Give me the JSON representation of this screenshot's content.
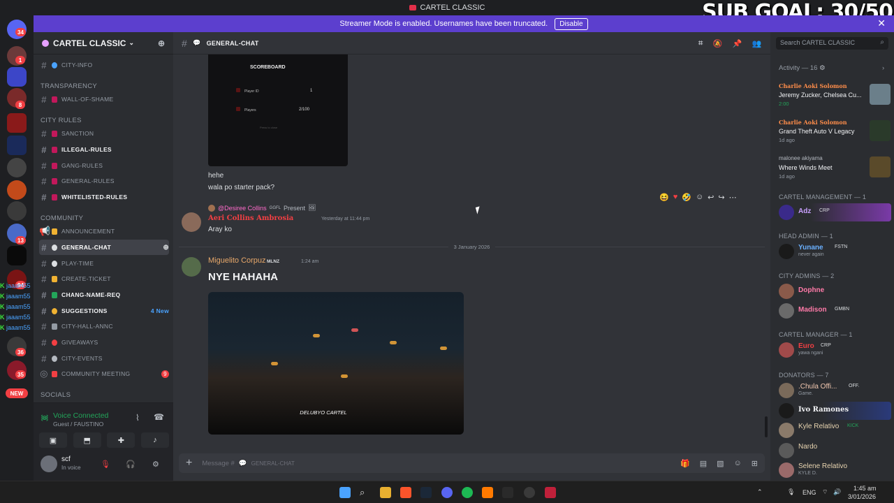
{
  "window": {
    "title": "CARTEL CLASSIC"
  },
  "overlay": {
    "sub_goal": "SUB GOAL: 30/50",
    "names": [
      "jaaam55",
      "jaaam55",
      "jaaam55",
      "jaaam55",
      "jaaam55"
    ]
  },
  "banner": {
    "text": "Streamer Mode is enabled. Usernames have been truncated.",
    "button": "Disable"
  },
  "rail": {
    "badges": [
      "34",
      "1",
      "8",
      "13",
      "94",
      "36",
      "35"
    ],
    "new_label": "NEW"
  },
  "server": {
    "name": "CARTEL CLASSIC"
  },
  "channels": {
    "city_info": "CITY-INFO",
    "cat_transparency": "TRANSPARENCY",
    "wall_of_shame": "WALL-OF-SHAME",
    "cat_city_rules": "CITY RULES",
    "sanction": "SANCTION",
    "illegal_rules": "ILLEGAL-RULES",
    "gang_rules": "GANG-RULES",
    "general_rules": "GENERAL-RULES",
    "whitelisted_rules": "WHITELISTED-RULES",
    "cat_community": "COMMUNITY",
    "announcement": "ANNOUNCEMENT",
    "general_chat": "GENERAL-CHAT",
    "play_time": "PLAY-TIME",
    "create_ticket": "CREATE-TICKET",
    "chang_name_req": "CHANG-NAME-REQ",
    "suggestions": "SUGGESTIONS",
    "suggestions_count": "4 New",
    "city_hall_annc": "CITY-HALL-ANNC",
    "giveaways": "GIVEAWAYS",
    "city_events": "CITY-EVENTS",
    "community_meeting": "COMMUNITY MEETING",
    "community_meeting_count": "9",
    "cat_socials": "SOCIALS"
  },
  "voice": {
    "status": "Voice Connected",
    "channel": "Guest / FAUSTINO"
  },
  "user": {
    "name": "scf",
    "status": "In voice"
  },
  "chat": {
    "channel": "GENERAL-CHAT",
    "scoreboard": {
      "title": "SCOREBOARD",
      "row1_label": "Player ID",
      "row1_value": "1",
      "row2_label": "Players",
      "row2_value": "2/100",
      "footer": "Press to close"
    },
    "msg1": "hehe",
    "msg2": "wala po starter pack?",
    "reply_name": "@Desiree Collins",
    "reply_tag": "GGFL",
    "reply_text": "Present",
    "user2": "Aeri Collins Ambrosia",
    "user2_time": "Yesterday at 11:44 pm",
    "msg3": "Aray ko",
    "date_divider": "3 January 2026",
    "user3": "Miguelito Corpuz",
    "user3_tag": "MLNZ",
    "user3_time": "1:24 am",
    "msg4": "NYE HAHAHA",
    "image_caption": "DELUBYO CARTEL",
    "composer_placeholder": "Message #",
    "composer_channel": "GENERAL-CHAT"
  },
  "members": {
    "search_placeholder": "Search CARTEL CLASSIC",
    "activity_header": "Activity — 16",
    "activities": [
      {
        "name": "Charlie Aoki Solomon",
        "game": "Jeremy Zucker, Chelsea Cu...",
        "time": "2:00"
      },
      {
        "name": "Charlie Aoki Solomon",
        "game": "Grand Theft Auto V Legacy",
        "time": "1d ago"
      },
      {
        "name": "malonee akiyama",
        "game": "Where Winds Meet",
        "time": "1d ago"
      }
    ],
    "groups": {
      "cartel_management": "CARTEL MANAGEMENT — 1",
      "head_admin": "HEAD ADMIN — 1",
      "city_admins": "CITY ADMINS — 2",
      "cartel_manager": "CARTEL MANAGER — 1",
      "donators": "DONATORS — 7"
    },
    "list": {
      "adz": {
        "name": "Adz",
        "tag": "CRP"
      },
      "yunane": {
        "name": "Yunane",
        "tag": "FSTN",
        "status": "never again"
      },
      "dophne": {
        "name": "Dophne"
      },
      "madison": {
        "name": "Madison",
        "tag": "GMBN"
      },
      "euro": {
        "name": "Euro",
        "tag": "CRP",
        "status": "yawa ngani"
      },
      "chula": {
        "name": ".Chula Offi...",
        "tag": "OFF.",
        "status": "Game."
      },
      "ivo": {
        "name": "Ivo Ramones"
      },
      "kyle": {
        "name": "Kyle Relativo",
        "tag": "KICK"
      },
      "nardo": {
        "name": "Nardo"
      },
      "selene": {
        "name": "Selene Relativo",
        "status": "KYLE D."
      }
    }
  },
  "taskbar": {
    "lang": "ENG",
    "time": "1:45 am",
    "date": "3/01/2026"
  }
}
